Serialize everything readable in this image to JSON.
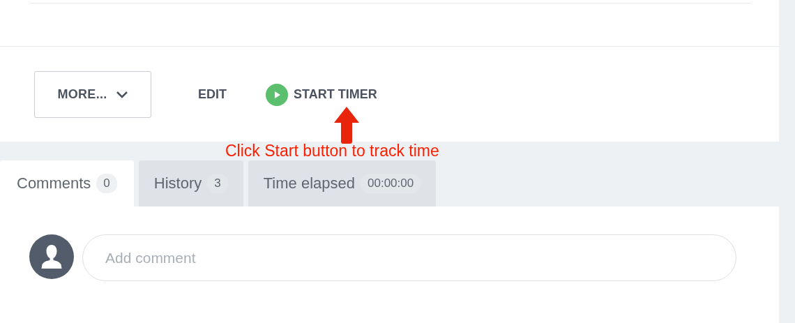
{
  "actions": [
    {
      "kind": "dropdown",
      "label": "MORE..."
    },
    {
      "kind": "link",
      "label": "EDIT"
    },
    {
      "kind": "timer",
      "label": "START TIMER"
    }
  ],
  "annotation": {
    "text": "Click Start button to track time"
  },
  "tabs": [
    {
      "label": "Comments",
      "count": "0",
      "selected": true
    },
    {
      "label": "History",
      "count": "3",
      "selected": false
    },
    {
      "label": "Time elapsed",
      "count": "00:00:00",
      "selected": false
    }
  ],
  "comment": {
    "placeholder": "Add comment"
  }
}
